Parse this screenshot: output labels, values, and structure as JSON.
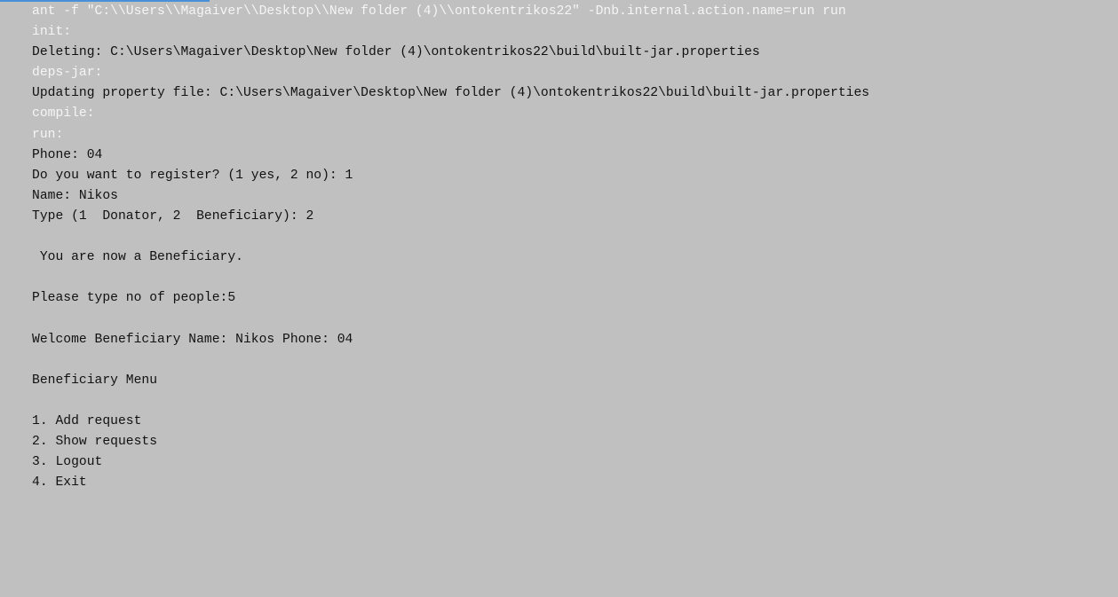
{
  "colors": {
    "background": "#c0c0c0",
    "output_text": "#111111",
    "target_text": "#f5f5f5",
    "accent": "#4a90d9"
  },
  "console": {
    "lines": [
      {
        "text": "ant -f \"C:\\\\Users\\\\Magaiver\\\\Desktop\\\\New folder (4)\\\\ontokentrikos22\" -Dnb.internal.action.name=run run",
        "kind": "target"
      },
      {
        "text": "init:",
        "kind": "target"
      },
      {
        "text": "Deleting: C:\\Users\\Magaiver\\Desktop\\New folder (4)\\ontokentrikos22\\build\\built-jar.properties",
        "kind": "output"
      },
      {
        "text": "deps-jar:",
        "kind": "target"
      },
      {
        "text": "Updating property file: C:\\Users\\Magaiver\\Desktop\\New folder (4)\\ontokentrikos22\\build\\built-jar.properties",
        "kind": "output"
      },
      {
        "text": "compile:",
        "kind": "target"
      },
      {
        "text": "run:",
        "kind": "target"
      },
      {
        "text": "Phone: 04",
        "kind": "output"
      },
      {
        "text": "Do you want to register? (1 yes, 2 no): 1",
        "kind": "output"
      },
      {
        "text": "Name: Nikos",
        "kind": "output"
      },
      {
        "text": "Type (1  Donator, 2  Beneficiary): 2",
        "kind": "output"
      },
      {
        "text": "",
        "kind": "output"
      },
      {
        "text": " You are now a Beneficiary.",
        "kind": "output"
      },
      {
        "text": "",
        "kind": "output"
      },
      {
        "text": "Please type no of people:5",
        "kind": "output"
      },
      {
        "text": "",
        "kind": "output"
      },
      {
        "text": "Welcome Beneficiary Name: Nikos Phone: 04",
        "kind": "output"
      },
      {
        "text": "",
        "kind": "output"
      },
      {
        "text": "Beneficiary Menu",
        "kind": "output"
      },
      {
        "text": "",
        "kind": "output"
      },
      {
        "text": "1. Add request",
        "kind": "output"
      },
      {
        "text": "2. Show requests",
        "kind": "output"
      },
      {
        "text": "3. Logout",
        "kind": "output"
      },
      {
        "text": "4. Exit",
        "kind": "output"
      }
    ]
  }
}
